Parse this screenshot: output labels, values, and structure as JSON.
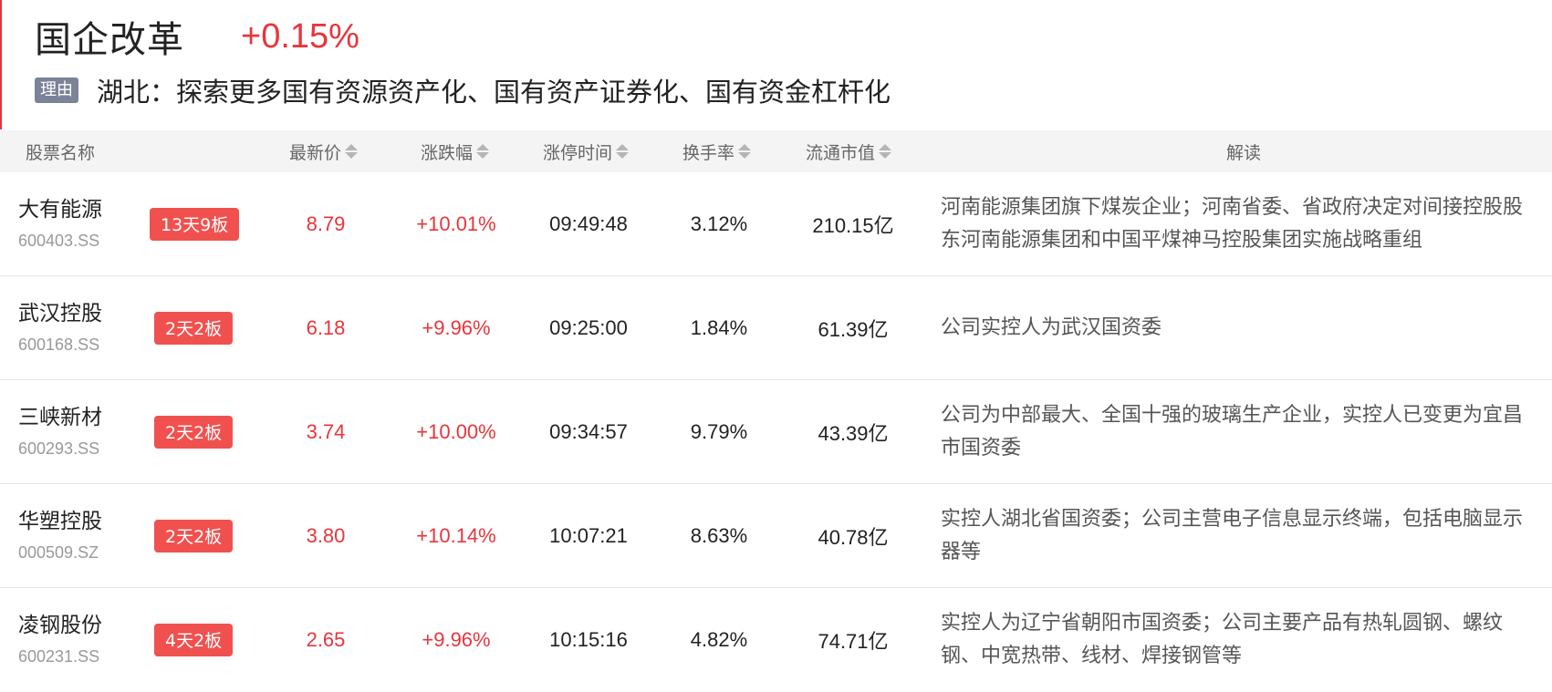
{
  "sector": {
    "name": "国企改革",
    "change": "+0.15%"
  },
  "reason": {
    "badge": "理由",
    "text": "湖北：探索更多国有资源资产化、国有资产证券化、国有资金杠杆化"
  },
  "columns": {
    "name": "股票名称",
    "price": "最新价",
    "change": "涨跌幅",
    "limit_time": "涨停时间",
    "turnover": "换手率",
    "market_cap": "流通市值",
    "reading": "解读"
  },
  "colors": {
    "up": "#e8353b",
    "badge": "#f0514f",
    "reason_badge": "#7a8397"
  },
  "rows": [
    {
      "name": "大有能源",
      "code": "600403.SS",
      "badge": "13天9板",
      "price": "8.79",
      "change": "+10.01%",
      "time": "09:49:48",
      "turnover": "3.12%",
      "cap": "210.15亿",
      "reading": "河南能源集团旗下煤炭企业；河南省委、省政府决定对间接控股股东河南能源集团和中国平煤神马控股集团实施战略重组"
    },
    {
      "name": "武汉控股",
      "code": "600168.SS",
      "badge": "2天2板",
      "price": "6.18",
      "change": "+9.96%",
      "time": "09:25:00",
      "turnover": "1.84%",
      "cap": "61.39亿",
      "reading": "公司实控人为武汉国资委"
    },
    {
      "name": "三峡新材",
      "code": "600293.SS",
      "badge": "2天2板",
      "price": "3.74",
      "change": "+10.00%",
      "time": "09:34:57",
      "turnover": "9.79%",
      "cap": "43.39亿",
      "reading": "公司为中部最大、全国十强的玻璃生产企业，实控人已变更为宜昌市国资委"
    },
    {
      "name": "华塑控股",
      "code": "000509.SZ",
      "badge": "2天2板",
      "price": "3.80",
      "change": "+10.14%",
      "time": "10:07:21",
      "turnover": "8.63%",
      "cap": "40.78亿",
      "reading": "实控人湖北省国资委；公司主营电子信息显示终端，包括电脑显示器等"
    },
    {
      "name": "凌钢股份",
      "code": "600231.SS",
      "badge": "4天2板",
      "price": "2.65",
      "change": "+9.96%",
      "time": "10:15:16",
      "turnover": "4.82%",
      "cap": "74.71亿",
      "reading": "实控人为辽宁省朝阳市国资委；公司主要产品有热轧圆钢、螺纹钢、中宽热带、线材、焊接钢管等"
    }
  ]
}
